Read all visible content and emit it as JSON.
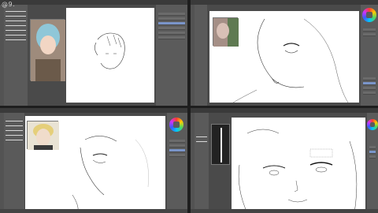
{
  "watermark": "@9.",
  "panes": [
    {
      "name": "top-left",
      "caption": ""
    },
    {
      "name": "top-right",
      "caption": ""
    },
    {
      "name": "bottom-left",
      "caption": ""
    },
    {
      "name": "bottom-right",
      "caption": ""
    }
  ],
  "colors": {
    "ui_dark": "#3a3a3a",
    "ui_panel": "#5b5b5b",
    "canvas": "#ffffff",
    "selected_layer": "#7a95c9"
  },
  "icons": [
    "color-wheel-icon",
    "brush-icon",
    "layer-icon"
  ]
}
